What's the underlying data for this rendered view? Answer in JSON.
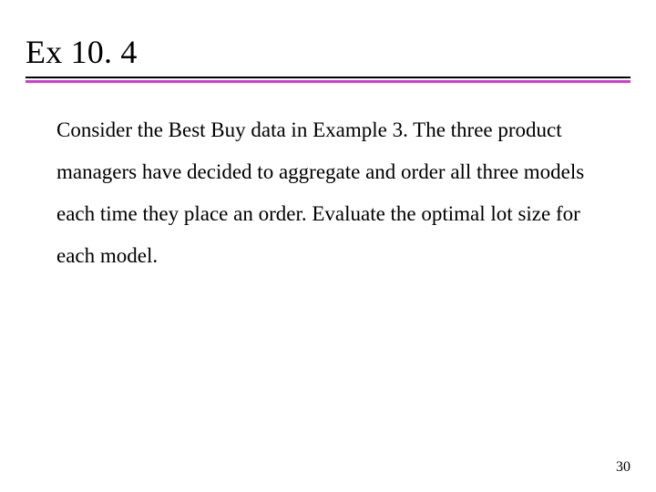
{
  "slide": {
    "heading": "Ex 10. 4",
    "body": "Consider the Best Buy data in Example 3. The three product managers have decided to aggregate and order all three models each time they place an order. Evaluate the optimal lot size for each model.",
    "page_number": "30"
  }
}
